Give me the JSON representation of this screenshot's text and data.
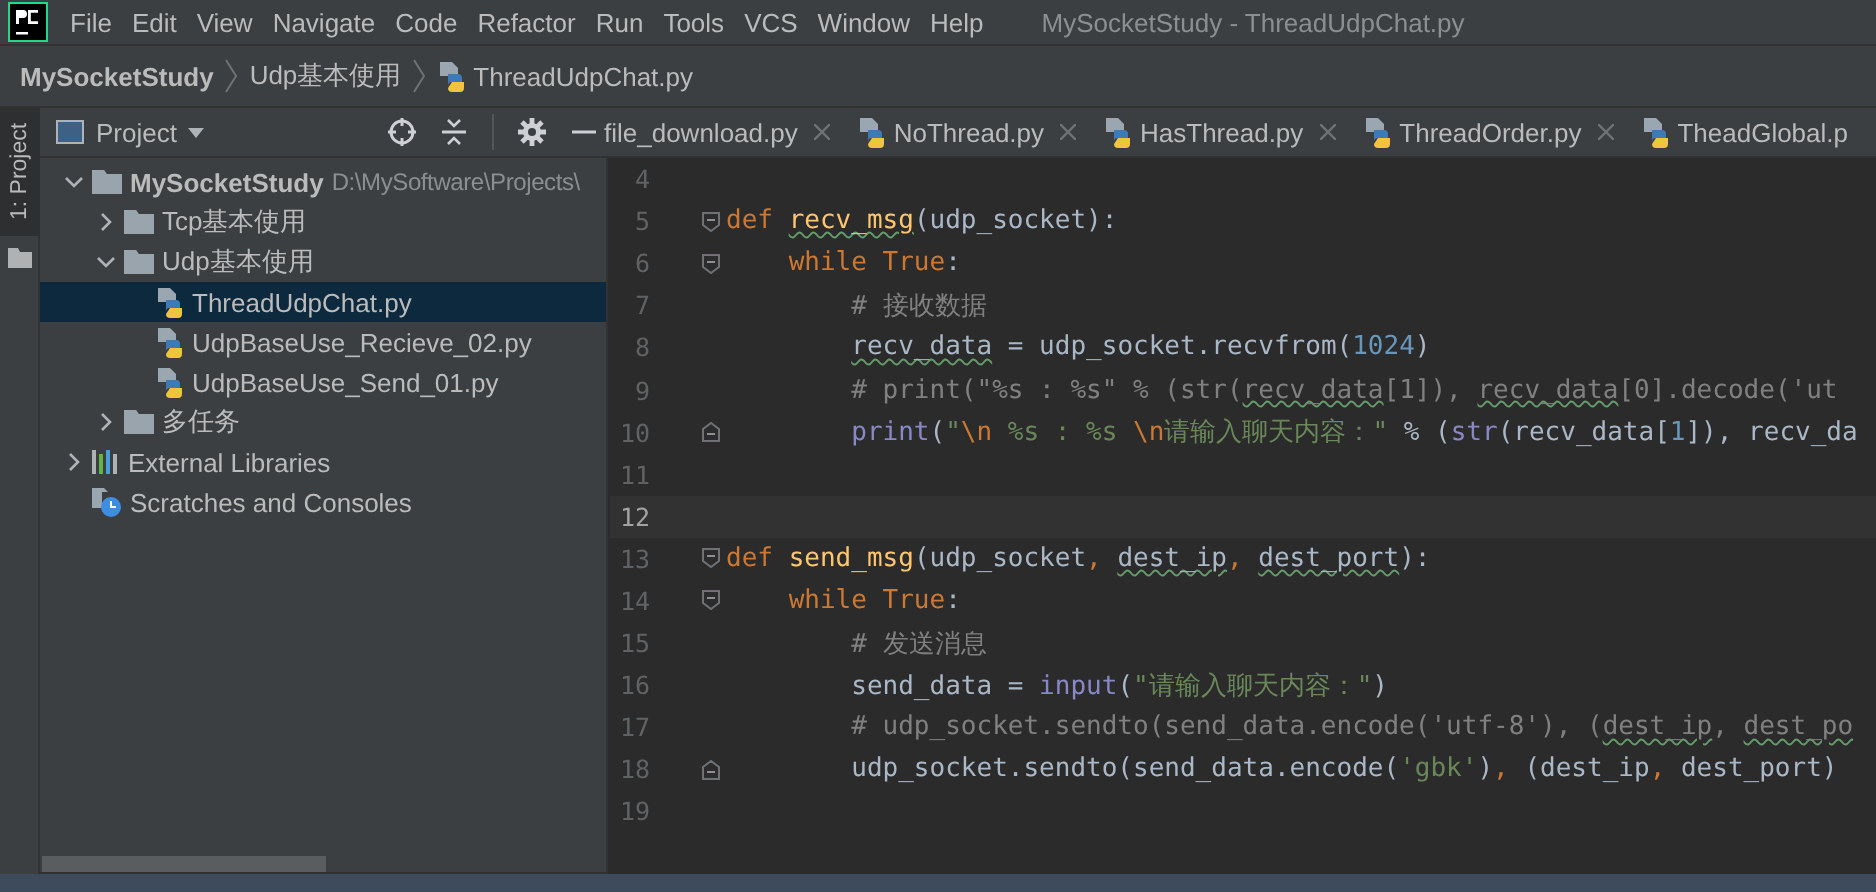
{
  "window": {
    "title": "MySocketStudy - ThreadUdpChat.py"
  },
  "menu": [
    "File",
    "Edit",
    "View",
    "Navigate",
    "Code",
    "Refactor",
    "Run",
    "Tools",
    "VCS",
    "Window",
    "Help"
  ],
  "breadcrumb": [
    {
      "label": "MySocketStudy",
      "kind": "project"
    },
    {
      "label": "Udp基本使用",
      "kind": "folder"
    },
    {
      "label": "ThreadUdpChat.py",
      "kind": "file"
    }
  ],
  "side_strip": {
    "label": "1: Project"
  },
  "project_panel": {
    "title": "Project",
    "tree": [
      {
        "label": "MySocketStudy",
        "path": "D:\\MySoftware\\Projects\\",
        "kind": "folder",
        "expanded": true,
        "selected": false,
        "children": [
          {
            "label": "Tcp基本使用",
            "kind": "folder",
            "expanded": false,
            "selected": false
          },
          {
            "label": "Udp基本使用",
            "kind": "folder",
            "expanded": true,
            "selected": false,
            "children": [
              {
                "label": "ThreadUdpChat.py",
                "kind": "file",
                "selected": true
              },
              {
                "label": "UdpBaseUse_Recieve_02.py",
                "kind": "file",
                "selected": false
              },
              {
                "label": "UdpBaseUse_Send_01.py",
                "kind": "file",
                "selected": false
              }
            ]
          },
          {
            "label": "多任务",
            "kind": "folder",
            "expanded": false,
            "selected": false
          }
        ]
      },
      {
        "label": "External Libraries",
        "kind": "library",
        "expanded": false,
        "selected": false
      },
      {
        "label": "Scratches and Consoles",
        "kind": "scratches",
        "selected": false
      }
    ]
  },
  "tabs": [
    {
      "label": "file_download.py",
      "selected": false
    },
    {
      "label": "NoThread.py",
      "selected": false
    },
    {
      "label": "HasThread.py",
      "selected": false
    },
    {
      "label": "ThreadOrder.py",
      "selected": false
    },
    {
      "label": "TheadGlobal.p",
      "selected": false
    }
  ],
  "code": [
    {
      "number": "4",
      "current": false
    },
    {
      "number": "5",
      "current": false,
      "fold_start": true,
      "tokens": [
        {
          "text": "def ",
          "kind": "keyword"
        },
        {
          "text": "recv_msg",
          "kind": "function",
          "typo": true
        },
        {
          "text": "(udp_socket):",
          "kind": "plain"
        }
      ]
    },
    {
      "number": "6",
      "current": false,
      "fold_start": true,
      "tokens": [
        {
          "text": "    while True",
          "kind": "keyword"
        },
        {
          "text": ":",
          "kind": "plain"
        }
      ]
    },
    {
      "number": "7",
      "current": false,
      "tokens": [
        {
          "text": "        # 接收数据",
          "kind": "comment"
        }
      ]
    },
    {
      "number": "8",
      "current": false,
      "tokens": [
        {
          "text": "        recv_data",
          "kind": "plain",
          "typo": true
        },
        {
          "text": " = udp_socket.recvfrom(",
          "kind": "plain"
        },
        {
          "text": "1024",
          "kind": "number"
        },
        {
          "text": ")",
          "kind": "plain"
        }
      ]
    },
    {
      "number": "9",
      "current": false,
      "tokens": [
        {
          "text": "        # print(\"%s : %s\" % (str(",
          "kind": "comment"
        },
        {
          "text": "recv_data",
          "kind": "comment",
          "typo": true
        },
        {
          "text": "[1]), ",
          "kind": "comment"
        },
        {
          "text": "recv_data",
          "kind": "comment",
          "typo": true
        },
        {
          "text": "[0].decode('ut",
          "kind": "comment"
        }
      ]
    },
    {
      "number": "10",
      "current": false,
      "fold_end": true,
      "tokens": [
        {
          "text": "        print",
          "kind": "builtin"
        },
        {
          "text": "(",
          "kind": "plain"
        },
        {
          "text": "\"",
          "kind": "string"
        },
        {
          "text": "\\n",
          "kind": "escape"
        },
        {
          "text": " %s : %s ",
          "kind": "string"
        },
        {
          "text": "\\n",
          "kind": "escape"
        },
        {
          "text": "请输入聊天内容：\"",
          "kind": "string"
        },
        {
          "text": " % (",
          "kind": "plain"
        },
        {
          "text": "str",
          "kind": "builtin"
        },
        {
          "text": "(recv_data[",
          "kind": "plain"
        },
        {
          "text": "1",
          "kind": "number"
        },
        {
          "text": "]), recv_da",
          "kind": "plain"
        }
      ]
    },
    {
      "number": "11",
      "current": false
    },
    {
      "number": "12",
      "current": true
    },
    {
      "number": "13",
      "current": false,
      "fold_start": true,
      "tokens": [
        {
          "text": "def ",
          "kind": "keyword"
        },
        {
          "text": "send_msg",
          "kind": "function"
        },
        {
          "text": "(udp_socket",
          "kind": "plain"
        },
        {
          "text": ", ",
          "kind": "keyword"
        },
        {
          "text": "dest_ip",
          "kind": "plain",
          "typo": true
        },
        {
          "text": ", ",
          "kind": "keyword"
        },
        {
          "text": "dest_port",
          "kind": "plain",
          "typo": true
        },
        {
          "text": "):",
          "kind": "plain"
        }
      ]
    },
    {
      "number": "14",
      "current": false,
      "fold_start": true,
      "tokens": [
        {
          "text": "    while True",
          "kind": "keyword"
        },
        {
          "text": ":",
          "kind": "plain"
        }
      ]
    },
    {
      "number": "15",
      "current": false,
      "tokens": [
        {
          "text": "        # 发送消息",
          "kind": "comment"
        }
      ]
    },
    {
      "number": "16",
      "current": false,
      "tokens": [
        {
          "text": "        send_data = ",
          "kind": "plain"
        },
        {
          "text": "input",
          "kind": "builtin"
        },
        {
          "text": "(",
          "kind": "plain"
        },
        {
          "text": "\"请输入聊天内容：\"",
          "kind": "string"
        },
        {
          "text": ")",
          "kind": "plain"
        }
      ]
    },
    {
      "number": "17",
      "current": false,
      "tokens": [
        {
          "text": "        # udp_socket.sendto(send_data.encode('utf-8'), (",
          "kind": "comment"
        },
        {
          "text": "dest_ip",
          "kind": "comment",
          "typo": true
        },
        {
          "text": ", ",
          "kind": "comment"
        },
        {
          "text": "dest_po",
          "kind": "comment",
          "typo": true
        }
      ]
    },
    {
      "number": "18",
      "current": false,
      "fold_end": true,
      "tokens": [
        {
          "text": "        udp_socket.sendto(send_data.encode(",
          "kind": "plain"
        },
        {
          "text": "'gbk'",
          "kind": "string"
        },
        {
          "text": ")",
          "kind": "plain"
        },
        {
          "text": ", ",
          "kind": "keyword"
        },
        {
          "text": "(dest_ip",
          "kind": "plain"
        },
        {
          "text": ", ",
          "kind": "keyword"
        },
        {
          "text": "dest_port)",
          "kind": "plain"
        }
      ]
    },
    {
      "number": "19",
      "current": false
    }
  ]
}
